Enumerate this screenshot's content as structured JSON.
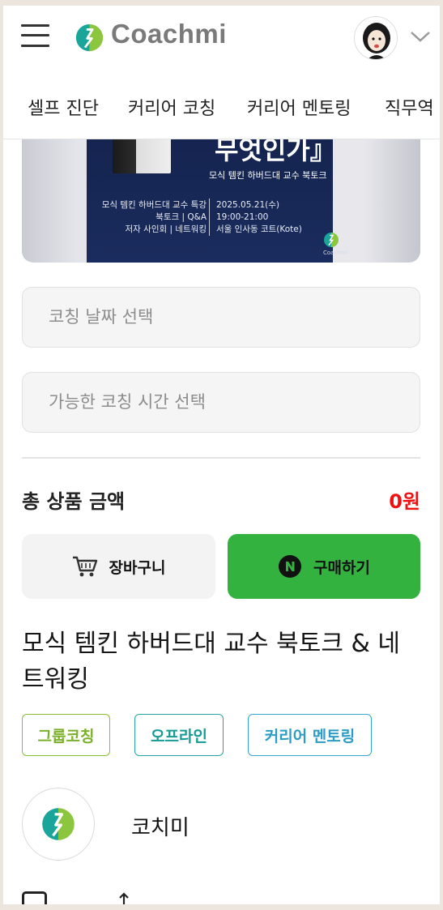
{
  "header": {
    "logo_text": "Coachmi",
    "colors": {
      "logo_green": "#8cc63f",
      "logo_teal": "#1aa59b",
      "logo_text": "#7a7a7a"
    }
  },
  "nav": {
    "items": [
      "셀프 진단",
      "커리어 코칭",
      "커리어 멘토링",
      "직무역"
    ]
  },
  "banner": {
    "title": "무엇인가』",
    "subtitle": "모식 템킨 하버드대 교수 북토크",
    "left_lines": [
      "모식 템킨 하버드대 교수 특강",
      "북토크 | Q&A",
      "저자 사인회 | 네트워킹"
    ],
    "right_lines": [
      "2025.05.21(수)",
      "19:00-21:00",
      "서울 인사동 코트(Kote)"
    ],
    "logo_text": "Coachmi"
  },
  "form": {
    "date_placeholder": "코칭 날짜 선택",
    "time_placeholder": "가능한 코칭 시간 선택"
  },
  "total": {
    "label": "총 상품 금액",
    "value": "0원",
    "color": "#ee1111"
  },
  "buttons": {
    "cart_label": "장바구니",
    "buy_label": "구매하기",
    "buy_color": "#34b240"
  },
  "product": {
    "title": "모식 템킨 하버드대 교수 북토크 & 네트워킹",
    "tags": [
      "그룹코칭",
      "오프라인",
      "커리어 멘토링"
    ]
  },
  "coach": {
    "name": "코치미"
  },
  "icons": [
    "menu-icon",
    "coachmi-logo-icon",
    "chevron-down-icon",
    "cart-icon",
    "naver-n-icon",
    "checkbox-icon",
    "share-icon"
  ]
}
